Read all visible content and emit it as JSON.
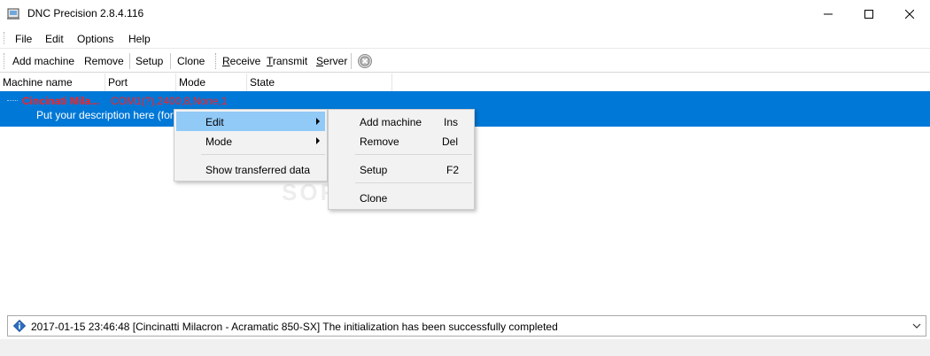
{
  "window": {
    "title": "DNC Precision 2.8.4.116"
  },
  "menu": {
    "items": [
      "File",
      "Edit",
      "Options",
      "Help"
    ]
  },
  "toolbar": {
    "add_machine": "Add machine",
    "remove": "Remove",
    "setup": "Setup",
    "clone": "Clone",
    "receive_u": "R",
    "receive_rest": "eceive",
    "transmit_u": "T",
    "transmit_rest": "ransmit",
    "server_u": "S",
    "server_rest": "erver",
    "stop_icon": "stop-circle-icon"
  },
  "list": {
    "columns": [
      "Machine name",
      "Port",
      "Mode",
      "State"
    ],
    "rows": [
      {
        "name": "Cincinati Mila...",
        "port": "COM1(?),2400,8,None,1",
        "description": "Put your description here (for exa"
      }
    ]
  },
  "context_menu": {
    "items": [
      {
        "label": "Edit",
        "has_submenu": true,
        "highlighted": true
      },
      {
        "label": "Mode",
        "has_submenu": true,
        "highlighted": false
      },
      {
        "label": "Show transferred data",
        "has_submenu": false,
        "highlighted": false
      }
    ]
  },
  "submenu": {
    "items": [
      {
        "label": "Add machine",
        "shortcut": "Ins"
      },
      {
        "label": "Remove",
        "shortcut": "Del"
      },
      {
        "label": "Setup",
        "shortcut": "F2"
      },
      {
        "label": "Clone",
        "shortcut": ""
      }
    ]
  },
  "status": {
    "message": "2017-01-15 23:46:48 [Cincinatti Milacron - Acramatic 850-SX] The initialization has been successfully completed"
  },
  "watermark": "SOFTPEDIA",
  "colors": {
    "selection": "#0078d7",
    "highlight": "#91c9f7",
    "machine_text": "#ff1f1f"
  }
}
